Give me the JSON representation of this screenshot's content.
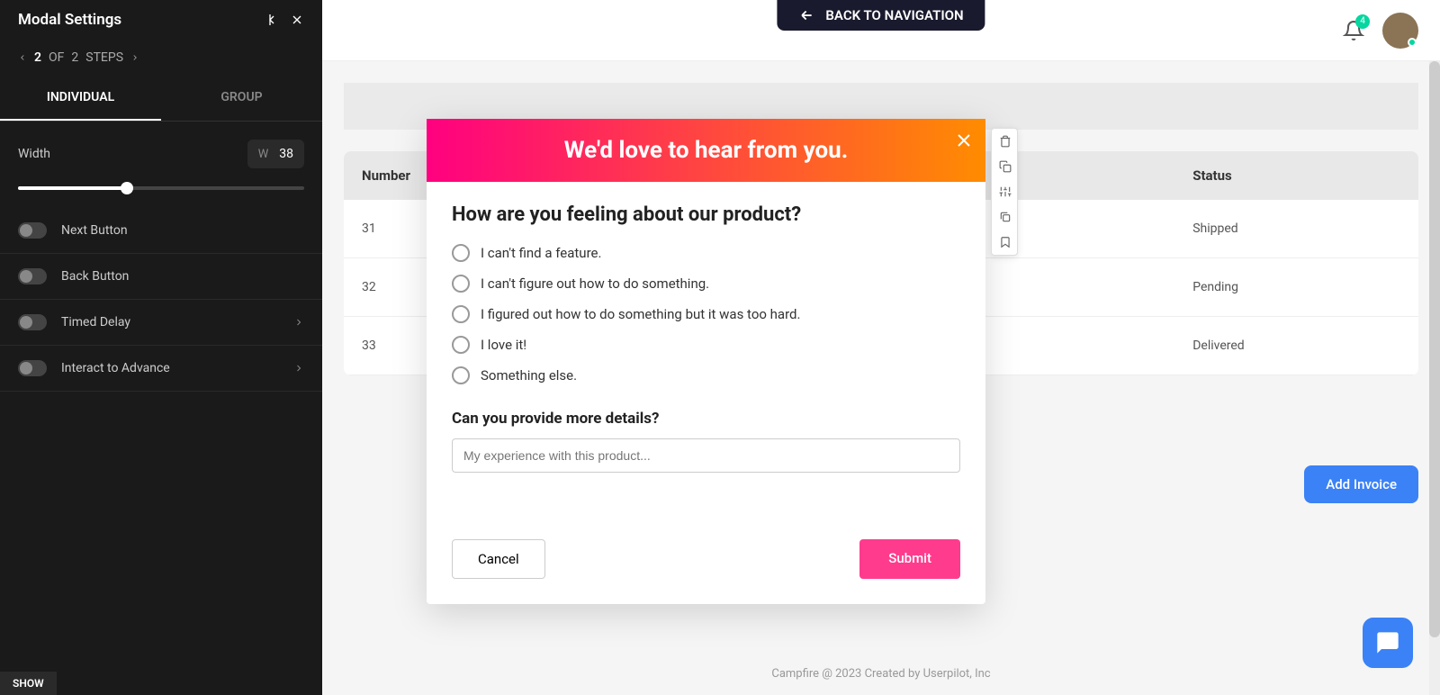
{
  "topbar": {
    "back_label": "BACK TO NAVIGATION",
    "notif_count": "4"
  },
  "sidebar": {
    "title": "Modal Settings",
    "step_current": "2",
    "step_of": "OF",
    "step_total": "2",
    "step_label": "STEPS",
    "tabs": {
      "individual": "INDIVIDUAL",
      "group": "GROUP"
    },
    "width_label": "Width",
    "width_unit": "W",
    "width_value": "38",
    "settings": [
      {
        "label": "Next Button",
        "has_chevron": false
      },
      {
        "label": "Back Button",
        "has_chevron": false
      },
      {
        "label": "Timed Delay",
        "has_chevron": true
      },
      {
        "label": "Interact to Advance",
        "has_chevron": true
      }
    ],
    "show": "SHOW"
  },
  "table": {
    "headers": {
      "number": "Number",
      "status": "Status"
    },
    "rows": [
      {
        "number": "31",
        "status": "Shipped"
      },
      {
        "number": "32",
        "status": "Pending"
      },
      {
        "number": "33",
        "status": "Delivered"
      }
    ],
    "add_invoice": "Add Invoice"
  },
  "modal": {
    "banner": "We'd love to hear from you.",
    "q1": "How are you feeling about our product?",
    "options": [
      "I can't find a feature.",
      "I can't figure out how to do something.",
      "I figured out how to do something but it was too hard.",
      "I love it!",
      "Something else."
    ],
    "q2": "Can you provide more details?",
    "placeholder": "My experience with this product...",
    "cancel": "Cancel",
    "submit": "Submit"
  },
  "footer": "Campfire @ 2023 Created by Userpilot, Inc"
}
